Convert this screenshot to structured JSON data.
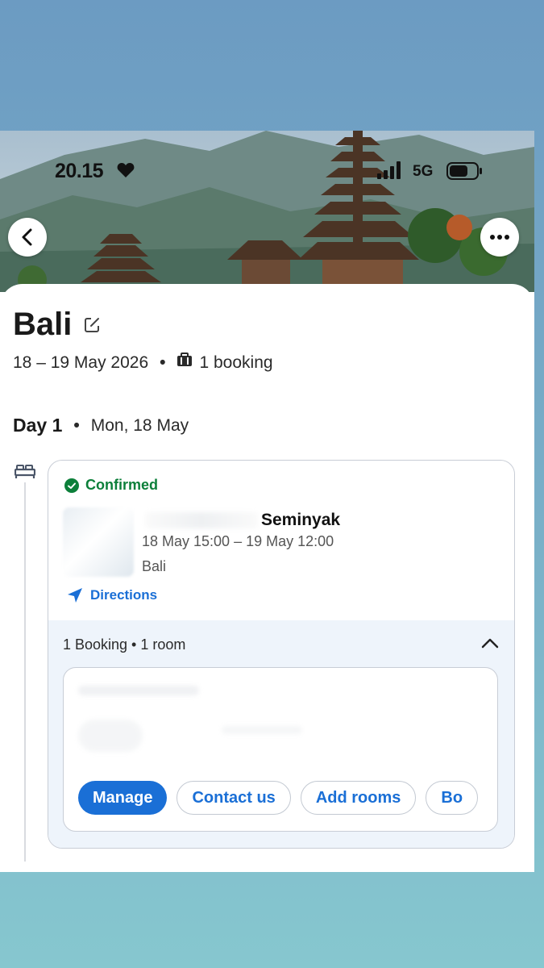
{
  "status_bar": {
    "time": "20.15",
    "network": "5G",
    "icons": [
      "heart-icon",
      "signal-bars-icon",
      "battery-icon"
    ]
  },
  "header": {
    "back_icon": "chevron-left-icon",
    "more_icon": "ellipsis-icon"
  },
  "trip": {
    "title": "Bali",
    "edit_icon": "edit-icon",
    "dates": "18 – 19 May 2026",
    "bookings_count": "1 booking",
    "bookings_icon": "briefcase-icon"
  },
  "day": {
    "label": "Day 1",
    "date": "Mon, 18 May"
  },
  "booking": {
    "status": "Confirmed",
    "hotel_name": "Seminyak",
    "stay": "18 May 15:00 – 19 May 12:00",
    "city": "Bali",
    "directions_label": "Directions",
    "summary": "1 Booking • 1 room",
    "actions": [
      "Manage",
      "Contact us",
      "Add rooms",
      "Bo"
    ]
  },
  "colors": {
    "accent": "#1a6fd6",
    "confirmed": "#0c7f3a",
    "panel_bg": "#eef4fb"
  }
}
